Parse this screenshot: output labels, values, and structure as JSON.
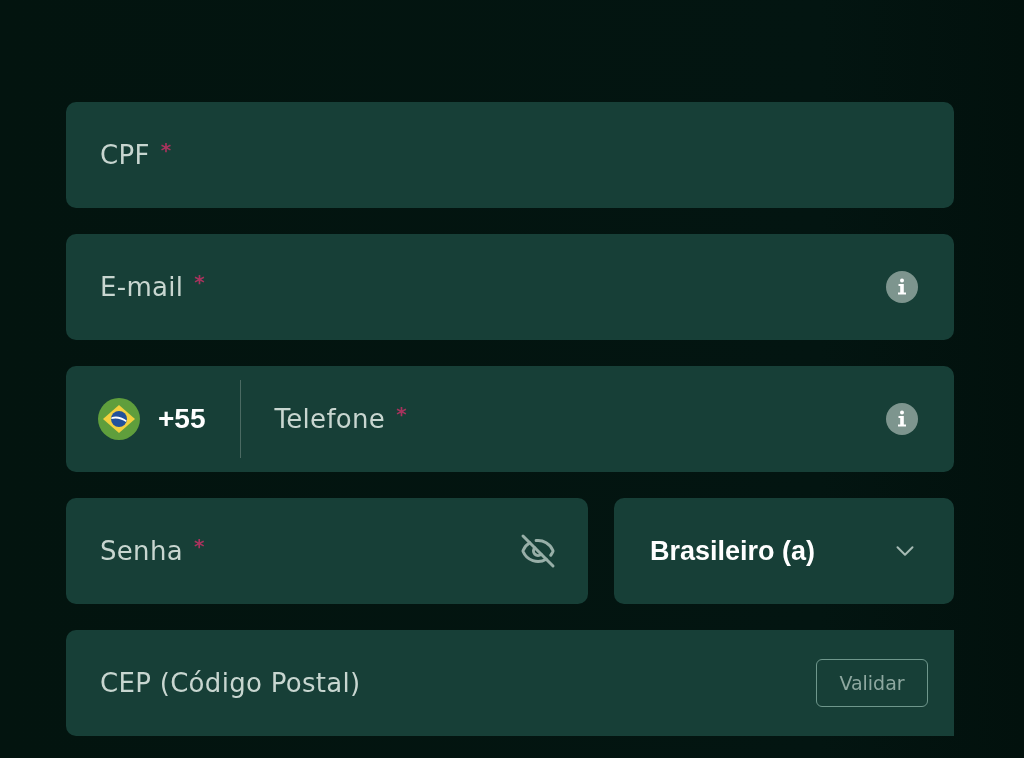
{
  "form": {
    "fields": [
      {
        "kind": "text",
        "label": "CPF",
        "required_mark": "*",
        "info": false
      },
      {
        "kind": "text",
        "label": "E-mail",
        "required_mark": "*",
        "info": true
      },
      {
        "kind": "phone",
        "dial_code": "+55",
        "label": "Telefone",
        "required_mark": "*",
        "info": true
      },
      {
        "kind": "pair",
        "items": [
          {
            "kind": "password",
            "label": "Senha",
            "required_mark": "*",
            "visible": false
          },
          {
            "kind": "select",
            "value": "Brasileiro (a)"
          }
        ]
      },
      {
        "kind": "postal",
        "label": "CEP (Código Postal)",
        "button": "Validar"
      }
    ]
  }
}
